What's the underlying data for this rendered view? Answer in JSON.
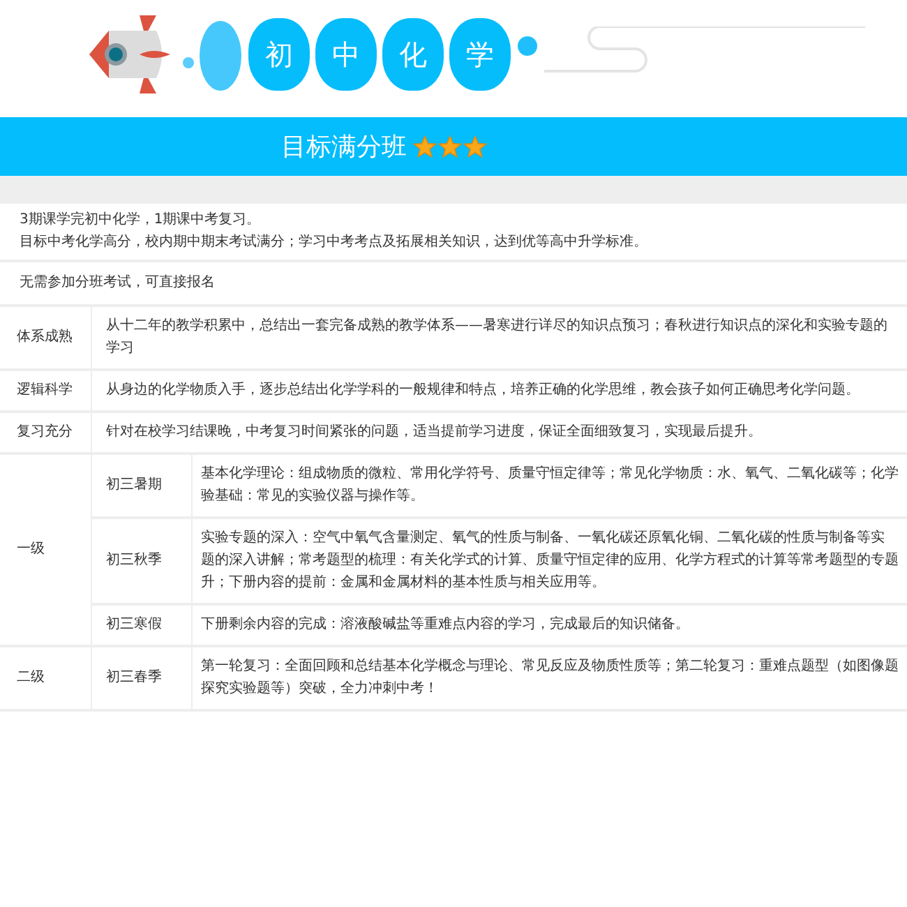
{
  "header": {
    "title_chars": [
      "初",
      "中",
      "化",
      "学"
    ]
  },
  "banner": {
    "title": "目标满分班",
    "stars": 3
  },
  "intro": {
    "lines": [
      "3期课学完初中化学，1期课中考复习。",
      "目标中考化学高分，校内期中期末考试满分；学习中考考点及拓展相关知识，达到优等高中升学标准。"
    ]
  },
  "enrollment": "无需参加分班考试，可直接报名",
  "features": [
    {
      "label": "体系成熟",
      "text": "从十二年的教学积累中，总结出一套完备成熟的教学体系——暑寒进行详尽的知识点预习；春秋进行知识点的深化和实验专题的学习"
    },
    {
      "label": "逻辑科学",
      "text": "从身边的化学物质入手，逐步总结出化学学科的一般规律和特点，培养正确的化学思维，教会孩子如何正确思考化学问题。"
    },
    {
      "label": "复习充分",
      "text": "针对在校学习结课晚，中考复习时间紧张的问题，适当提前学习进度，保证全面细致复习，实现最后提升。"
    }
  ],
  "levels": [
    {
      "level": "一级",
      "terms": [
        {
          "term": "初三暑期",
          "lines": [
            "基本化学理论：组成物质的微粒、常用化学符号、质量守恒定律等；常见化学物质：水、氧气、二氧化碳等；化学",
            "验基础：常见的实验仪器与操作等。"
          ]
        },
        {
          "term": "初三秋季",
          "lines": [
            "实验专题的深入：空气中氧气含量测定、氧气的性质与制备、一氧化碳还原氧化铜、二氧化碳的性质与制备等实",
            "题的深入讲解；常考题型的梳理：有关化学式的计算、质量守恒定律的应用、化学方程式的计算等常考题型的专题",
            "升；下册内容的提前：金属和金属材料的基本性质与相关应用等。"
          ]
        },
        {
          "term": "初三寒假",
          "lines": [
            "下册剩余内容的完成：溶液酸碱盐等重难点内容的学习，完成最后的知识储备。"
          ]
        }
      ]
    },
    {
      "level": "二级",
      "terms": [
        {
          "term": "初三春季",
          "lines": [
            "第一轮复习：全面回顾和总结基本化学概念与理论、常见反应及物质性质等；第二轮复习：重难点题型（如图像题",
            "探究实验题等）突破，全力冲刺中考！"
          ]
        }
      ]
    }
  ]
}
